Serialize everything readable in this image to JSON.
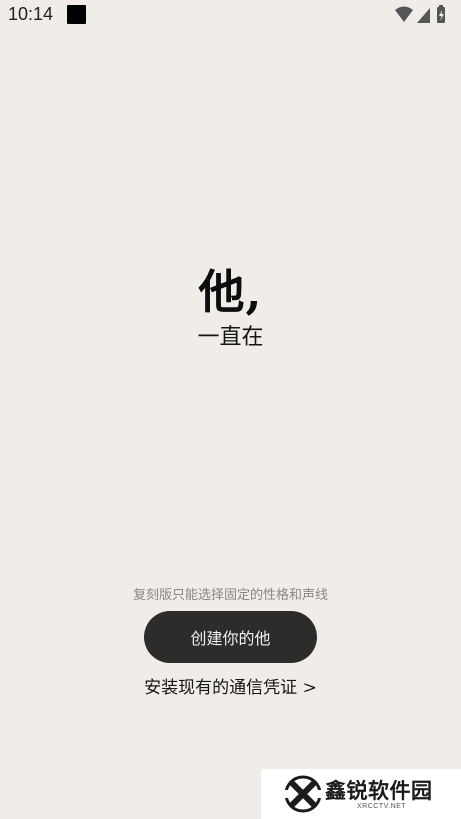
{
  "status_bar": {
    "time": "10:14",
    "icons": [
      "wifi-icon",
      "signal-icon",
      "battery-icon"
    ]
  },
  "intro": {
    "headline": "他,",
    "subline": "一直在"
  },
  "hint": "复刻版只能选择固定的性格和声线",
  "actions": {
    "create_label": "创建你的他",
    "install_link": "安装现有的通信凭证 >"
  },
  "watermark": {
    "title": "鑫锐软件园",
    "subtitle": "XRCCTV.NET"
  },
  "colors": {
    "background": "#f0ece8",
    "button": "#2d2c2b",
    "button_text": "#f2f0ee",
    "hint_text": "#8a8784"
  }
}
